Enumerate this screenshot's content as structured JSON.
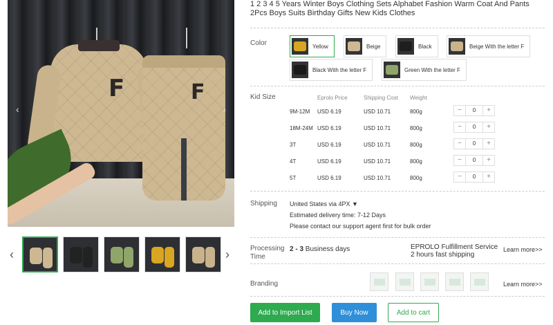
{
  "product": {
    "title": "1 2 3 4 5 Years Winter Boys Clothing Sets Alphabet Fashion Warm Coat And Pants 2Pcs Boys Suits Birthday Gifts New Kids Clothes"
  },
  "gallery": {
    "prev_arrow": "‹",
    "next_arrow": "›",
    "thumb_prev": "‹",
    "thumb_next": "›",
    "main_letter": "F",
    "thumbnails": [
      {
        "color": "#cdb892",
        "active": true
      },
      {
        "color": "#222222",
        "active": false
      },
      {
        "color": "#8fa56a",
        "active": false
      },
      {
        "color": "#d9a623",
        "active": false
      },
      {
        "color": "#c9b38c",
        "active": false
      }
    ]
  },
  "color": {
    "label": "Color",
    "options": [
      {
        "label": "Yellow",
        "swatch": "#d9a623",
        "selected": true
      },
      {
        "label": "Beige",
        "swatch": "#cdb892",
        "selected": false
      },
      {
        "label": "Black",
        "swatch": "#1e1e1e",
        "selected": false
      },
      {
        "label": "Beige With the letter F",
        "swatch": "#c9b38c",
        "selected": false
      },
      {
        "label": "Black With the letter F",
        "swatch": "#1a1a1a",
        "selected": false
      },
      {
        "label": "Green With the letter F",
        "swatch": "#8fa56a",
        "selected": false
      }
    ]
  },
  "size_table": {
    "label": "Kid Size",
    "headers": {
      "price": "Eprolo Price",
      "shipping": "Shipping Cost",
      "weight": "Weight"
    },
    "rows": [
      {
        "size": "9M-12M",
        "price": "USD 6.19",
        "shipping": "USD 10.71",
        "weight": "800g",
        "qty": "0"
      },
      {
        "size": "18M-24M",
        "price": "USD 6.19",
        "shipping": "USD 10.71",
        "weight": "800g",
        "qty": "0"
      },
      {
        "size": "3T",
        "price": "USD 6.19",
        "shipping": "USD 10.71",
        "weight": "800g",
        "qty": "0"
      },
      {
        "size": "4T",
        "price": "USD 6.19",
        "shipping": "USD 10.71",
        "weight": "800g",
        "qty": "0"
      },
      {
        "size": "5T",
        "price": "USD 6.19",
        "shipping": "USD 10.71",
        "weight": "800g",
        "qty": "0"
      }
    ],
    "minus": "−",
    "plus": "+"
  },
  "shipping": {
    "label": "Shipping",
    "destination": "United States via 4PX ▼",
    "delivery": "Estimated delivery time: 7-12 Days",
    "notice": "Please contact our support agent first for bulk order"
  },
  "processing": {
    "label_line1": "Processing",
    "label_line2": "Time",
    "days_bold": "2 - 3",
    "days_text": "Business days",
    "service_line1": "EPROLO Fulfillment Service",
    "service_line2": "2 hours fast shipping",
    "learn_more": "Learn more>>"
  },
  "branding": {
    "label": "Branding",
    "learn_more": "Learn more>>"
  },
  "actions": {
    "import": "Add to Import List",
    "buy": "Buy Now",
    "cart": "Add to cart"
  }
}
